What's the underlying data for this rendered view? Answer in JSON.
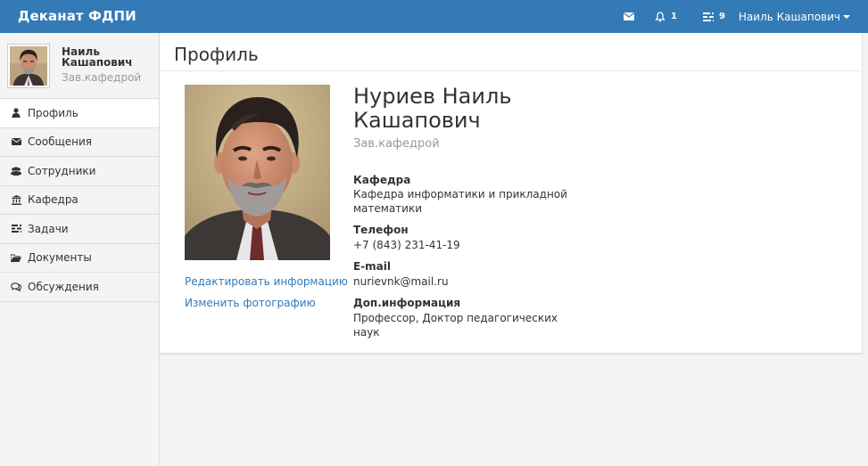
{
  "navbar": {
    "brand": "Деканат ФДПИ",
    "messages_icon": "envelope-icon",
    "notifications": {
      "icon": "bell-icon",
      "count": "1"
    },
    "tasks": {
      "icon": "tasks-icon",
      "count": "9"
    },
    "user_menu_label": "Наиль Кашапович"
  },
  "sidebar": {
    "user": {
      "name_line1": "Наиль",
      "name_line2": "Кашапович",
      "role": "Зав.кафедрой"
    },
    "items": [
      {
        "label": "Профиль",
        "icon": "user-icon",
        "active": true
      },
      {
        "label": "Сообщения",
        "icon": "envelope-icon",
        "active": false
      },
      {
        "label": "Сотрудники",
        "icon": "users-icon",
        "active": false
      },
      {
        "label": "Кафедра",
        "icon": "institution-icon",
        "active": false
      },
      {
        "label": "Задачи",
        "icon": "tasks-icon",
        "active": false
      },
      {
        "label": "Документы",
        "icon": "folder-open-icon",
        "active": false
      },
      {
        "label": "Обсуждения",
        "icon": "comments-icon",
        "active": false
      }
    ]
  },
  "main": {
    "page_title": "Профиль",
    "profile": {
      "full_name_line1": "Нуриев Наиль",
      "full_name_line2": "Кашапович",
      "position": "Зав.кафедрой",
      "fields": [
        {
          "label": "Кафедра",
          "value_line1": "Кафедра информатики и прикладной",
          "value_line2": "математики"
        },
        {
          "label": "Телефон",
          "value_line1": "+7 (843) 231-41-19"
        },
        {
          "label": "E-mail",
          "value_line1": "nurievnk@mail.ru"
        },
        {
          "label": "Доп.информация",
          "value_line1": "Профессор, Доктор педагогических наук"
        }
      ]
    },
    "actions": {
      "edit_info": "Редактировать информацию",
      "change_photo": "Изменить фотографию"
    }
  },
  "colors": {
    "navbar": "#337ab7",
    "link": "#337ab7",
    "muted": "#999999"
  }
}
